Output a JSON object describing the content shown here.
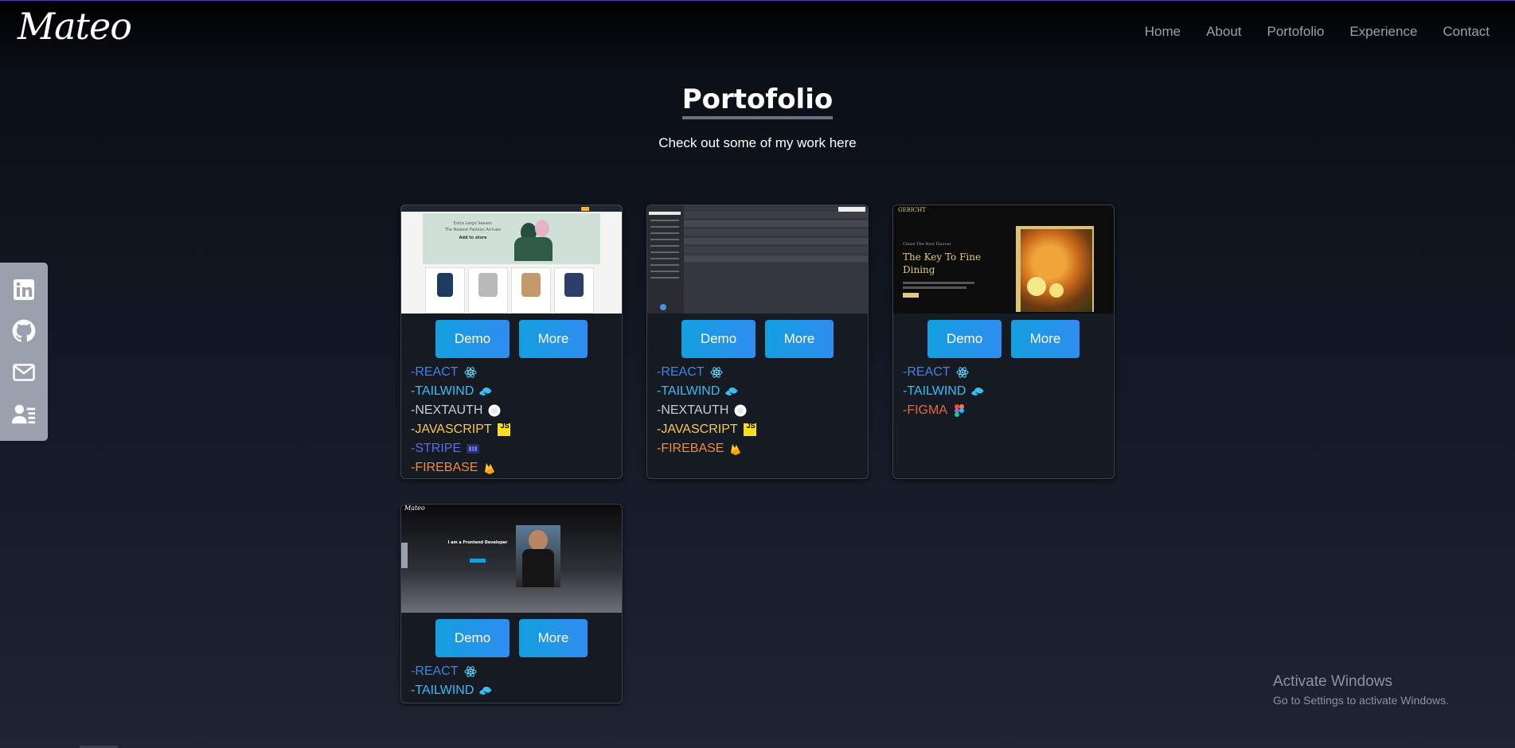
{
  "header": {
    "logo": "Mateo",
    "nav": [
      {
        "label": "Home"
      },
      {
        "label": "About"
      },
      {
        "label": "Portofolio"
      },
      {
        "label": "Experience"
      },
      {
        "label": "Contact"
      }
    ]
  },
  "section": {
    "title": "Portofolio",
    "subtitle": "Check out some of my work here"
  },
  "social": [
    {
      "icon": "linkedin-icon"
    },
    {
      "icon": "github-icon"
    },
    {
      "icon": "mail-icon"
    },
    {
      "icon": "resume-icon"
    }
  ],
  "projects": [
    {
      "demo_label": "Demo",
      "more_label": "More",
      "thumb": {
        "desc": "E-commerce store",
        "banner_line1": "Extra Large Season",
        "banner_line2": "The Newest Fashion Arrivals",
        "banner_cta": "Add to store"
      },
      "techs": [
        {
          "label": "-REACT",
          "color": "#3f83e6",
          "icon": "react-icon"
        },
        {
          "label": "-TAILWIND",
          "color": "#38bdf8",
          "icon": "tailwind-icon"
        },
        {
          "label": "-NEXTAUTH",
          "color": "#c8ccd2",
          "icon": "nextauth-icon"
        },
        {
          "label": "-JAVASCRIPT",
          "color": "#f7c948",
          "icon": "javascript-icon",
          "badge": "JS"
        },
        {
          "label": "-STRIPE",
          "color": "#5a6cf2",
          "icon": "stripe-icon"
        },
        {
          "label": "-FIREBASE",
          "color": "#f28c3a",
          "icon": "firebase-icon"
        }
      ]
    },
    {
      "demo_label": "Demo",
      "more_label": "More",
      "thumb": {
        "desc": "Chat application"
      },
      "techs": [
        {
          "label": "-REACT",
          "color": "#3f83e6",
          "icon": "react-icon"
        },
        {
          "label": "-TAILWIND",
          "color": "#38bdf8",
          "icon": "tailwind-icon"
        },
        {
          "label": "-NEXTAUTH",
          "color": "#c8ccd2",
          "icon": "nextauth-icon"
        },
        {
          "label": "-JAVASCRIPT",
          "color": "#f7c948",
          "icon": "javascript-icon",
          "badge": "JS"
        },
        {
          "label": "-FIREBASE",
          "color": "#f28c3a",
          "icon": "firebase-icon"
        }
      ]
    },
    {
      "demo_label": "Demo",
      "more_label": "More",
      "thumb": {
        "desc": "Restaurant landing page",
        "brand": "GERICHT",
        "kicker": "Chase The New Flavour",
        "headline_1": "The Key To Fine",
        "headline_2": "Dining"
      },
      "techs": [
        {
          "label": "-REACT",
          "color": "#3f83e6",
          "icon": "react-icon"
        },
        {
          "label": "-TAILWIND",
          "color": "#38bdf8",
          "icon": "tailwind-icon"
        },
        {
          "label": "-FIGMA",
          "color": "#e8663d",
          "icon": "figma-icon"
        }
      ]
    },
    {
      "demo_label": "Demo",
      "more_label": "More",
      "thumb": {
        "desc": "Personal portfolio",
        "brand": "Mateo",
        "headline": "I am a Frontend Developer"
      },
      "techs": [
        {
          "label": "-REACT",
          "color": "#3f83e6",
          "icon": "react-icon"
        },
        {
          "label": "-TAILWIND",
          "color": "#38bdf8",
          "icon": "tailwind-icon"
        }
      ]
    }
  ],
  "watermark": {
    "line1": "Activate Windows",
    "line2": "Go to Settings to activate Windows."
  }
}
